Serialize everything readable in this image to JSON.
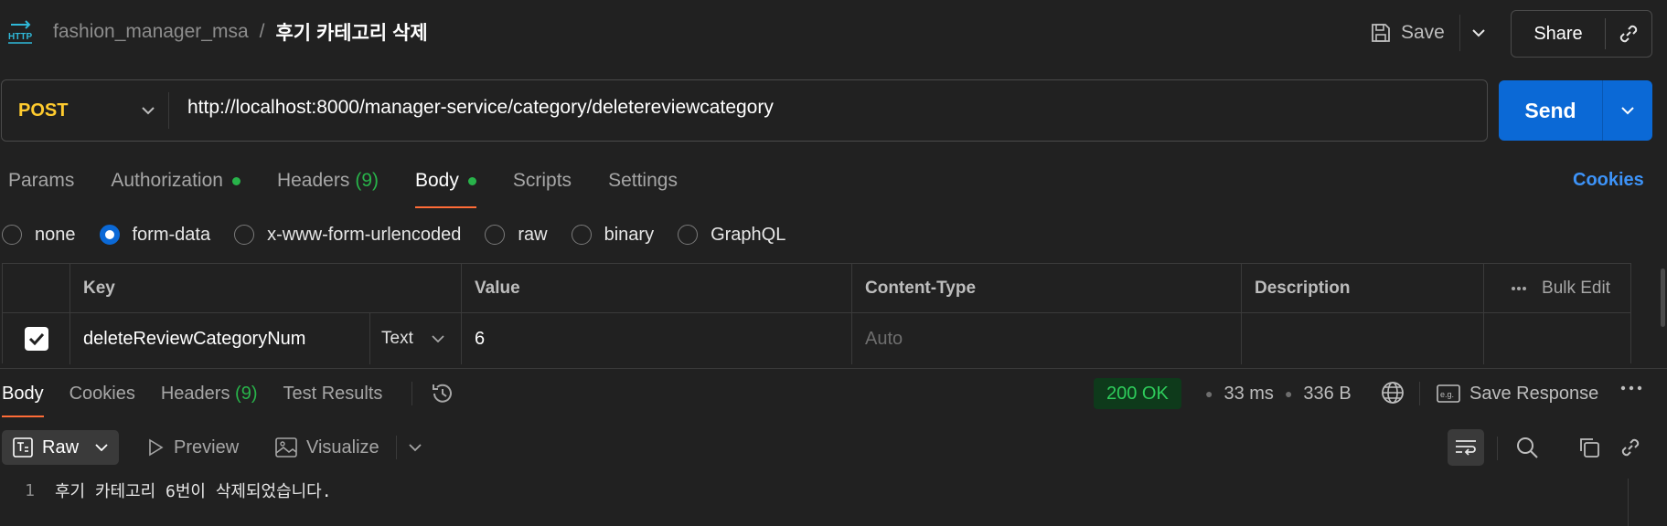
{
  "header": {
    "collection": "fashion_manager_msa",
    "separator": "/",
    "request_name": "후기 카테고리 삭제",
    "save_label": "Save",
    "share_label": "Share",
    "icons": {
      "http": "http-icon",
      "save": "save-icon",
      "share_link": "link-icon"
    }
  },
  "request": {
    "method": "POST",
    "url": "http://localhost:8000/manager-service/category/deletereviewcategory",
    "send_label": "Send"
  },
  "req_tabs": {
    "params": "Params",
    "authorization": "Authorization",
    "headers": "Headers",
    "headers_count": "(9)",
    "body": "Body",
    "scripts": "Scripts",
    "settings": "Settings",
    "active": "Body",
    "cookies": "Cookies"
  },
  "body_types": {
    "none": "none",
    "form_data": "form-data",
    "urlencoded": "x-www-form-urlencoded",
    "raw": "raw",
    "binary": "binary",
    "graphql": "GraphQL",
    "selected": "form-data"
  },
  "form_table": {
    "columns": {
      "key": "Key",
      "value": "Value",
      "content_type": "Content-Type",
      "description": "Description",
      "bulk_edit": "Bulk Edit"
    },
    "rows": [
      {
        "checked": true,
        "key": "deleteReviewCategoryNum",
        "type": "Text",
        "value": "6",
        "content_type": "Auto",
        "description": ""
      }
    ]
  },
  "response": {
    "tabs": {
      "body": "Body",
      "cookies": "Cookies",
      "headers": "Headers",
      "headers_count": "(9)",
      "test_results": "Test Results",
      "active": "Body"
    },
    "status": "200 OK",
    "time": "33 ms",
    "size": "336 B",
    "save_response": "Save Response",
    "view": {
      "raw": "Raw",
      "preview": "Preview",
      "visualize": "Visualize"
    },
    "lines": [
      {
        "no": "1",
        "text": "후기 카테고리 6번이 삭제되었습니다."
      }
    ]
  },
  "colors": {
    "background": "#212121",
    "accent_blue": "#0b69d6",
    "method_post": "#ffcb2e",
    "tab_underline": "#ff6c37",
    "status_green": "#2ecc5b",
    "link_blue": "#3d93f8"
  }
}
